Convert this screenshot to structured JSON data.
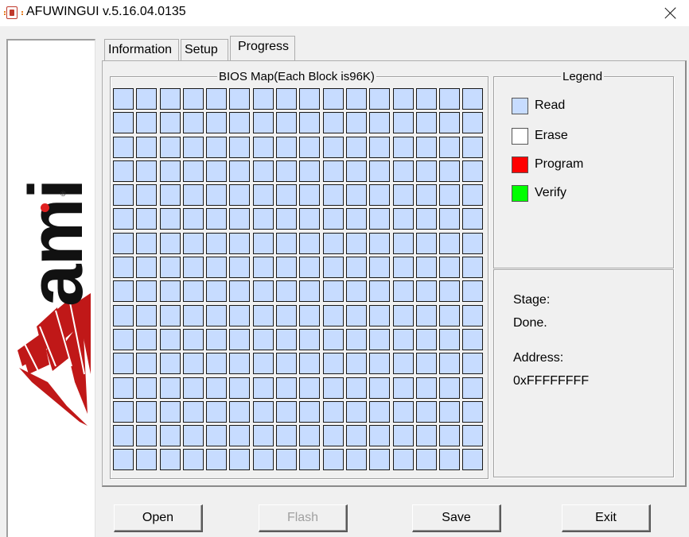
{
  "window": {
    "title": "AFUWINGUI v.5.16.04.0135"
  },
  "logo": {
    "text": "ami",
    "registered_mark": "®"
  },
  "tabs": [
    {
      "label": "Information",
      "active": false
    },
    {
      "label": "Setup",
      "active": false
    },
    {
      "label": "Progress",
      "active": true
    }
  ],
  "bios_map": {
    "title": "BIOS Map(Each Block is96K)",
    "rows": 16,
    "columns": 16,
    "block_state": "Read",
    "block_color": "#c7dcff"
  },
  "legend": {
    "title": "Legend",
    "items": [
      {
        "label": "Read",
        "color": "#c7dcff"
      },
      {
        "label": "Erase",
        "color": "#ffffff"
      },
      {
        "label": "Program",
        "color": "#ff0000"
      },
      {
        "label": "Verify",
        "color": "#00ff00"
      }
    ]
  },
  "status": {
    "stage_label": "Stage:",
    "stage_value": "Done.",
    "address_label": "Address:",
    "address_value": "0xFFFFFFFF"
  },
  "buttons": {
    "open": "Open",
    "flash": "Flash",
    "save": "Save",
    "exit": "Exit"
  },
  "colors": {
    "accent_red": "#e02020"
  }
}
